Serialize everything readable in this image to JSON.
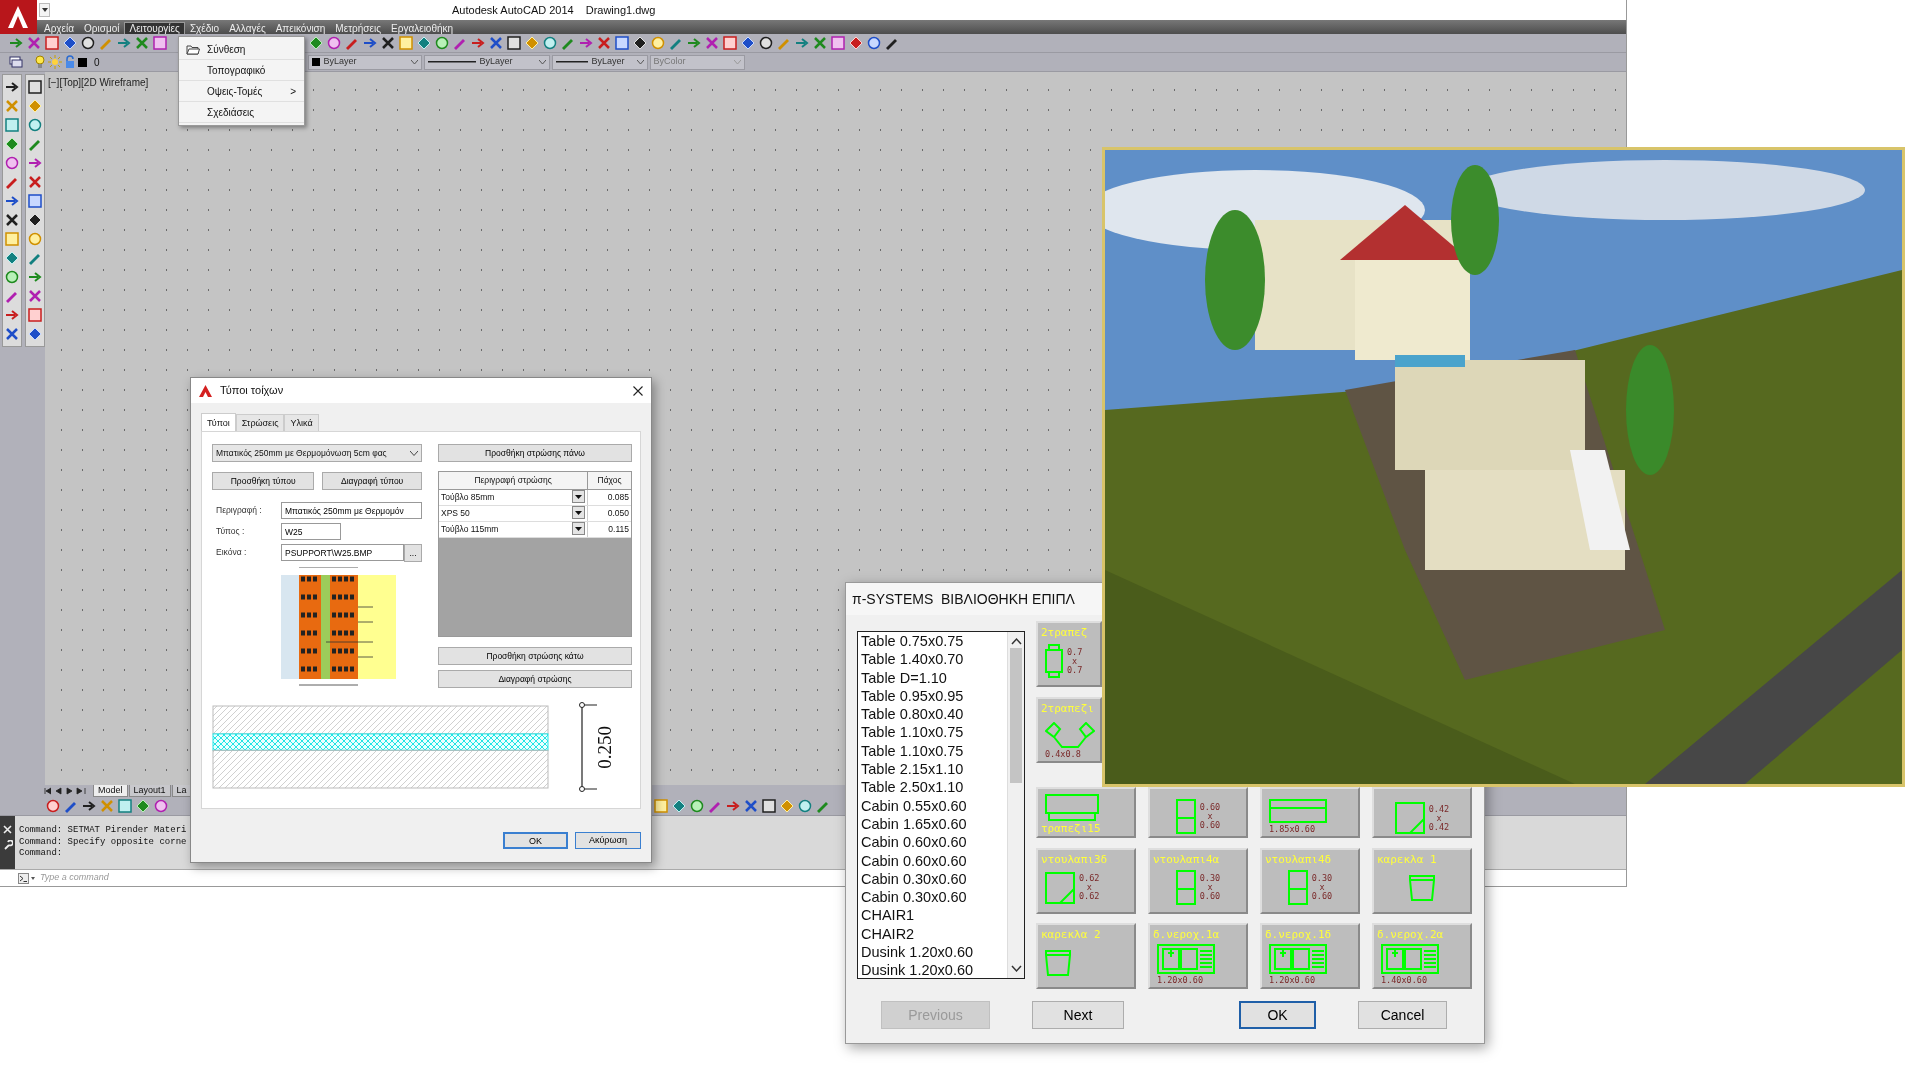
{
  "window": {
    "title": "Autodesk AutoCAD 2014",
    "document": "Drawing1.dwg"
  },
  "menu": [
    {
      "label": "Αρχεία",
      "selected": false
    },
    {
      "label": "Ορισμοί",
      "selected": false
    },
    {
      "label": "Λειτουργίες",
      "selected": true
    },
    {
      "label": "Σχέδιο",
      "selected": false
    },
    {
      "label": "Αλλαγές",
      "selected": false
    },
    {
      "label": "Απεικόνιση",
      "selected": false
    },
    {
      "label": "Μετρήσεις",
      "selected": false
    },
    {
      "label": "Εργαλειοθήκη",
      "selected": false
    }
  ],
  "open_menu": [
    {
      "label": "Σύνθεση",
      "kind": "folder"
    },
    {
      "label": "Τοπογραφικό",
      "kind": "plain"
    },
    {
      "label": "Οψεις-Τομές",
      "kind": "submenu",
      "arrow": ">"
    },
    {
      "label": "Σχεδιάσεις",
      "kind": "plain"
    }
  ],
  "layer_toolbar": {
    "layer": "0",
    "properties": [
      {
        "kind": "color",
        "value": "ByLayer",
        "disabled": false
      },
      {
        "kind": "linetype",
        "value": "ByLayer",
        "disabled": false
      },
      {
        "kind": "lineweight",
        "value": "ByLayer",
        "disabled": false
      },
      {
        "kind": "plot-style",
        "value": "ByColor",
        "disabled": true
      }
    ]
  },
  "viewport_label": "[−][Top][2D Wireframe]",
  "layout_tabs": [
    {
      "label": "Model",
      "selected": true
    },
    {
      "label": "Layout1",
      "selected": false
    },
    {
      "label": "La",
      "selected": false
    }
  ],
  "command_history": [
    "Command: SETMAT Pirender Materi",
    "Command: Specify opposite corne",
    "Command:"
  ],
  "command_line": {
    "placeholder": "Type a command"
  },
  "wall_dialog": {
    "title": "Τύποι τοίχων",
    "tabs": [
      {
        "label": "Τύποι",
        "selected": true
      },
      {
        "label": "Στρώσεις",
        "selected": false
      },
      {
        "label": "Υλικά",
        "selected": false
      }
    ],
    "type": "Μπατικός 250mm με Θερμομόνωση 5cm φας",
    "add_type": "Προσθήκη τύπου",
    "delete_type": "Διαγραφή τύπου",
    "fields": [
      {
        "label": "Περιγραφή :",
        "value": "Μπατικός 250mm με Θερμομόν"
      },
      {
        "label": "Τύπος :",
        "value": "W25"
      },
      {
        "label": "Εικόνα :",
        "value": "PSUPPORT\\W25.BMP",
        "browse": "..."
      }
    ],
    "preview": {
      "kind": "picture"
    },
    "add_layer_above": "Προσθήκη στρώσης πάνω",
    "columns": [
      "Περιγραφή στρώσης",
      "Πάχος"
    ],
    "layers": [
      {
        "material": "Τούβλο 85mm",
        "thickness": "0.085",
        "kind": "brick"
      },
      {
        "material": "XPS 50",
        "thickness": "0.050",
        "kind": "insulation"
      },
      {
        "material": "Τούβλο 115mm",
        "thickness": "0.115",
        "kind": "brick"
      }
    ],
    "add_layer_below": "Προσθήκη στρώσης κάτω",
    "delete_layer": "Διαγραφή στρώσης",
    "total_thickness": "0.250",
    "ok": "OK",
    "cancel": "Ακύρωση"
  },
  "library_dialog": {
    "title": "π-SYSTEMS  ΒΙΒΛΙΟΘΗΚΗ ΕΠΙΠΛ",
    "items": [
      "Table 0.75x0.75",
      "Table 1.40x0.70",
      "Table D=1.10",
      "Table 0.95x0.95",
      "Table 0.80x0.40",
      "Table 1.10x0.75",
      "Table 1.10x0.75",
      "Table 2.15x1.10",
      "Table 2.50x1.10",
      "Cabin 0.55x0.60",
      "Cabin 1.65x0.60",
      "Cabin 0.60x0.60",
      "Cabin 0.60x0.60",
      "Cabin 0.30x0.60",
      "Cabin 0.30x0.60",
      "CHAIR1",
      "CHAIR2",
      "Dusink 1.20x0.60",
      "Dusink 1.20x0.60"
    ],
    "tile_rows": [
      [
        {
          "kind": "table",
          "label": "2τραπεζ",
          "dims": [
            "0.7",
            "x",
            "0.7"
          ]
        }
      ],
      [
        {
          "kind": "angled-table",
          "label": "2τραπεζι",
          "dims": [
            "0.4x0.8"
          ]
        }
      ],
      [
        {
          "kind": "wide-table",
          "label": "τραπεζι15"
        },
        {
          "kind": "cabinet",
          "dims": [
            "0.60",
            "x",
            "0.60"
          ]
        },
        {
          "kind": "bench",
          "dims": [
            "1.85x0.60"
          ]
        },
        {
          "kind": "corner-cabinet",
          "dims": [
            "0.42",
            "x",
            "0.42"
          ]
        }
      ],
      [
        {
          "kind": "corner-cabinet",
          "label": "ντουλαπι3δ",
          "dims": [
            "0.62",
            "x",
            "0.62"
          ]
        },
        {
          "kind": "cabinet",
          "label": "ντουλαπι4α",
          "dims": [
            "0.30",
            "x",
            "0.60"
          ]
        },
        {
          "kind": "cabinet",
          "label": "ντουλαπι4δ",
          "dims": [
            "0.30",
            "x",
            "0.60"
          ]
        },
        {
          "kind": "chair",
          "label": "καρεκλα 1"
        }
      ],
      [
        {
          "kind": "chair",
          "label": "καρεκλα 2"
        },
        {
          "kind": "sink",
          "label": "δ.νεροχ.1α",
          "dims": [
            "1.20x0.60"
          ]
        },
        {
          "kind": "sink",
          "label": "δ.νεροχ.1δ",
          "dims": [
            "1.20x0.60"
          ]
        },
        {
          "kind": "sink",
          "label": "δ.νεροχ.2α",
          "dims": [
            "1.40x0.60"
          ]
        }
      ]
    ],
    "buttons": [
      {
        "label": "Previous",
        "disabled": true,
        "default": false
      },
      {
        "label": "Next",
        "disabled": false,
        "default": false
      },
      {
        "label": "OK",
        "disabled": false,
        "default": true
      },
      {
        "label": "Cancel",
        "disabled": false,
        "default": false
      }
    ]
  },
  "render": {
    "kind": "picture"
  }
}
